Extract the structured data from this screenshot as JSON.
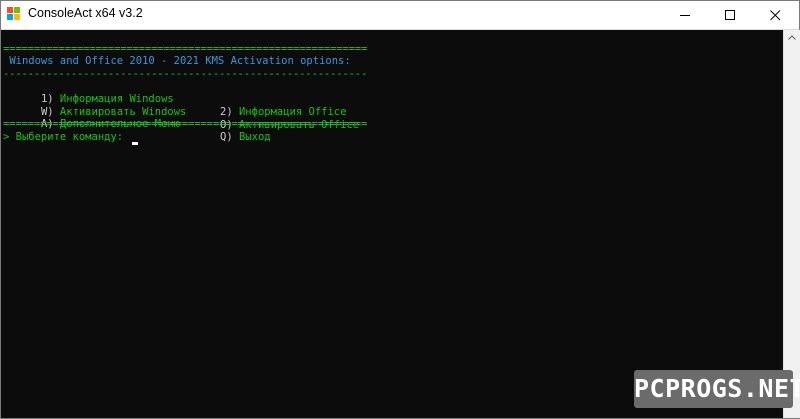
{
  "window": {
    "title": "ConsoleAct x64 v3.2",
    "controls": {
      "minimize": "minimize",
      "maximize": "maximize",
      "close": "close"
    }
  },
  "console": {
    "separator": "===========================================================",
    "separator2": "-----------------------------------------------------------",
    "heading": " Windows and Office 2010 - 2021 KMS Activation options:",
    "options": [
      {
        "key": "1)",
        "label": "Информация Windows",
        "key2": "2)",
        "label2": "Информация Office"
      },
      {
        "key": "W)",
        "label": "Активировать Windows",
        "key2": "O)",
        "label2": "Активировать Office"
      },
      {
        "key": "A)",
        "label": "Дополнительное Меню",
        "key2": "Q)",
        "label2": "Выход"
      }
    ],
    "prompt": "> Выберите команду: "
  },
  "watermark": {
    "text": "PCPROGS.NET"
  },
  "colors": {
    "console_bg": "#0c0c0c",
    "separator": "#2fba42",
    "heading": "#3a96dd",
    "option_key": "#cccccc",
    "option_label": "#16c60c"
  },
  "icons": {
    "app": "windows-logo-icon",
    "minimize": "minimize-icon",
    "maximize": "maximize-icon",
    "close": "close-icon",
    "scroll_up": "chevron-up-icon"
  }
}
